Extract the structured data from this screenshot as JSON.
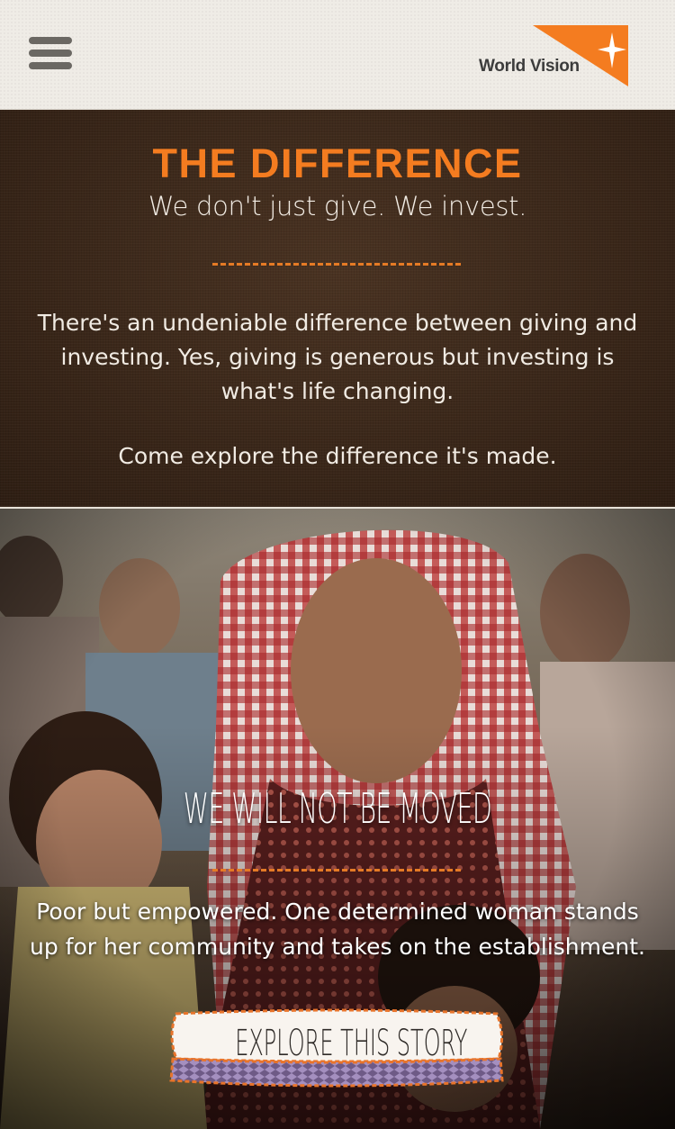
{
  "header": {
    "menu_icon": "hamburger-menu-icon",
    "logo_text": "World Vision",
    "logo_icon": "world-vision-star-icon"
  },
  "difference": {
    "title": "THE DIFFERENCE",
    "subtitle": "We don't just give. We invest.",
    "body": "There's an undeniable difference between giving and investing. Yes, giving is generous but investing is what's life changing.",
    "cta": "Come explore the difference it's made."
  },
  "story": {
    "title": "WE WILL NOT BE MOVED",
    "description": "Poor but empowered. One determined woman stands up for her community and takes on the establishment.",
    "button_label": "EXPLORE THIS STORY"
  },
  "colors": {
    "accent_orange": "#f47c20",
    "header_bg": "#efece6",
    "section_brown": "#3a2719"
  }
}
